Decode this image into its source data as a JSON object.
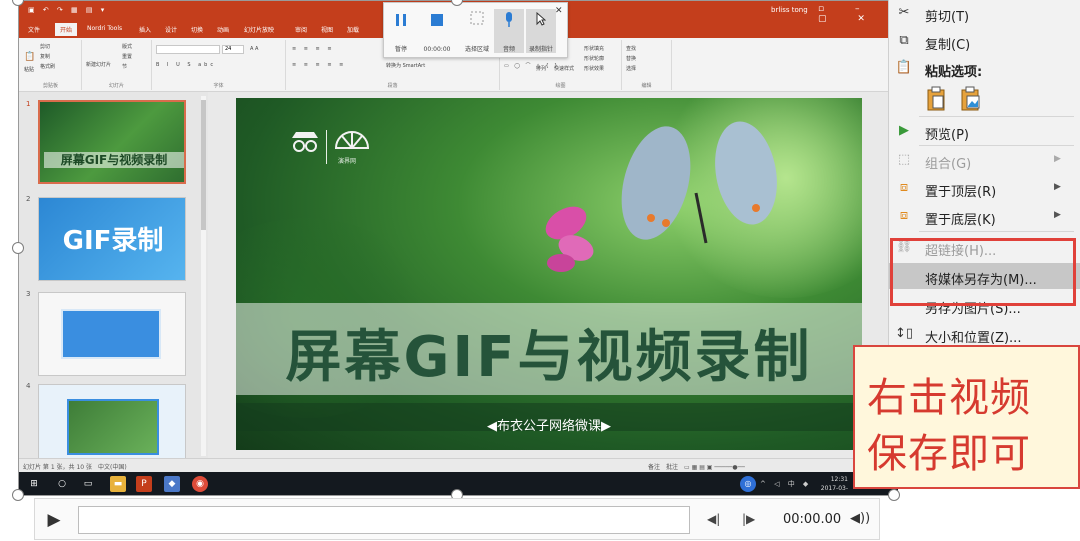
{
  "ppt": {
    "tabs": [
      "文件",
      "开始",
      "Nordri Tools",
      "插入",
      "设计",
      "切换",
      "动画",
      "幻灯片放映",
      "审阅",
      "视图",
      "加载"
    ],
    "active_tab": "开始",
    "user": "brliss tong",
    "ribbon_groups": [
      "剪贴板",
      "幻灯片",
      "字体",
      "段落",
      "绘图",
      "编辑"
    ],
    "ribbon_items": {
      "cut": "剪切",
      "copy": "复制",
      "paste": "粘贴",
      "format_painter": "格式刷",
      "new_slide": "新建幻灯片",
      "layout": "版式",
      "reset": "重置",
      "section": "节",
      "font_size": "24",
      "smartart": "转换为 SmartArt",
      "arrange": "排列",
      "quick_styles": "快速样式",
      "shape_fill": "形状填充",
      "shape_outline": "形状轮廓",
      "shape_effects": "形状效果",
      "find": "查找",
      "replace": "替换",
      "select": "选择"
    },
    "status_left": "幻灯片 第 1 张，共 10 张",
    "status_lang": "中文(中国)",
    "status_notes": "备注",
    "status_comments": "批注",
    "clock_time": "12:31",
    "clock_date": "2017-03-"
  },
  "recorder": {
    "pause": "暂停",
    "stop_time": "00:00:00",
    "select_area": "选择区域",
    "audio": "音频",
    "record_pointer": "录制指针"
  },
  "slides": {
    "nums": [
      "1",
      "2",
      "3",
      "4"
    ],
    "thumb1_title": "屏幕GIF与视频录制",
    "thumb2_title": "GIF录制"
  },
  "main_slide": {
    "title": "屏幕GIF与视频录制",
    "subtitle": "布衣公子网络微课",
    "logo_text": "演界网"
  },
  "media": {
    "time": "00:00.00"
  },
  "context_menu": {
    "cut": "剪切(T)",
    "copy": "复制(C)",
    "paste_options": "粘贴选项:",
    "preview": "预览(P)",
    "group": "组合(G)",
    "bring_front": "置于顶层(R)",
    "send_back": "置于底层(K)",
    "hyperlink": "超链接(H)...",
    "save_media_as": "将媒体另存为(M)...",
    "save_as_picture": "另存为图片(S)...",
    "size_position": "大小和位置(Z)..."
  },
  "callout": {
    "line1": "右击视频",
    "line2": "保存即可"
  },
  "colors": {
    "ppt_accent": "#c43e1c",
    "highlight_red": "#e0413a",
    "callout_text": "#d63a2f",
    "callout_bg": "#fff7dc"
  }
}
